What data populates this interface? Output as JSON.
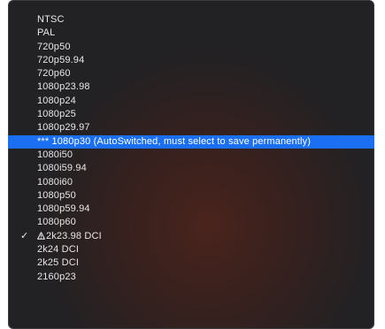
{
  "menu": {
    "items": [
      {
        "label": "NTSC"
      },
      {
        "label": "PAL"
      },
      {
        "label": "720p50"
      },
      {
        "label": "720p59.94"
      },
      {
        "label": "720p60"
      },
      {
        "label": "1080p23.98"
      },
      {
        "label": "1080p24"
      },
      {
        "label": "1080p25"
      },
      {
        "label": "1080p29.97"
      },
      {
        "label": "*** 1080p30 (AutoSwitched, must select to save permanently)",
        "highlighted": true
      },
      {
        "label": "1080i50"
      },
      {
        "label": "1080i59.94"
      },
      {
        "label": "1080i60"
      },
      {
        "label": "1080p50"
      },
      {
        "label": "1080p59.94"
      },
      {
        "label": "1080p60"
      },
      {
        "label": "2k23.98 DCI",
        "checked": true,
        "warning_icon": "warning-triangle-icon"
      },
      {
        "label": "2k24 DCI"
      },
      {
        "label": "2k25 DCI"
      },
      {
        "label": "2160p23"
      }
    ],
    "checkmark_glyph": "✓",
    "highlight_color": "#1b6ff2"
  }
}
